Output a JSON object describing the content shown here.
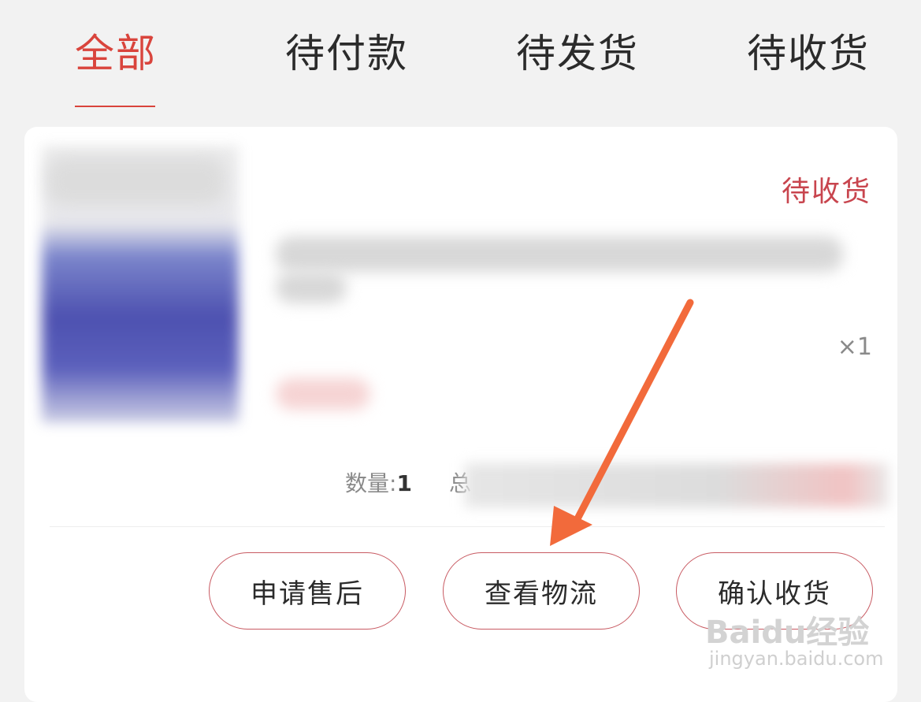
{
  "tabs": [
    {
      "label": "全部",
      "active": true
    },
    {
      "label": "待付款",
      "active": false
    },
    {
      "label": "待发货",
      "active": false
    },
    {
      "label": "待收货",
      "active": false
    }
  ],
  "order": {
    "status": "待收货",
    "quantity_mark": "×1",
    "count_label": "数量:",
    "count_value": "1",
    "total_label": "总"
  },
  "actions": {
    "after_sales": "申请售后",
    "view_logistics": "查看物流",
    "confirm_receipt": "确认收货"
  },
  "watermark": {
    "brand": "Baidu经验",
    "url": "jingyan.baidu.com"
  },
  "colors": {
    "accent": "#d9443c",
    "arrow": "#f26a3b"
  }
}
